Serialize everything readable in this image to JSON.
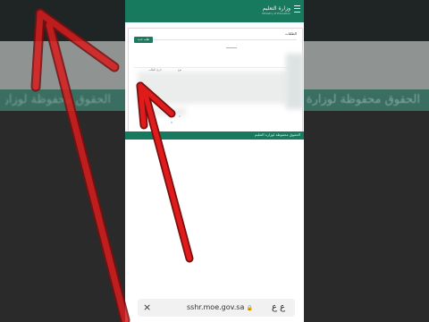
{
  "background": {
    "banner_text_right": "الحقوق محفوظة لوزارة التعليم",
    "banner_text_left": "الحقوق محفوظة لوزارة التعليم"
  },
  "header": {
    "logo_text": "وزارة التعليم",
    "logo_subtext": "Ministry of Education"
  },
  "card": {
    "title": "الطلبات",
    "button_label": "طلب جديد",
    "columns": [
      "تاريخ الطلب",
      "نوع"
    ],
    "row_values": [
      "1",
      "0"
    ]
  },
  "footer": {
    "text": "الحقوق محفوظة لوزارة التعليم"
  },
  "browser": {
    "close_glyph": "×",
    "url": "sshr.moe.gov.sa",
    "lock_glyph": "🔒",
    "text_size_glyph": "ع ع"
  },
  "colors": {
    "primary_green": "#17795d",
    "arrow_red": "#e01b1b",
    "arrow_outline": "#7a0f0f"
  },
  "icons": [
    "menu-icon",
    "close-icon",
    "lock-icon",
    "text-size-icon",
    "red-arrow-overlay"
  ]
}
